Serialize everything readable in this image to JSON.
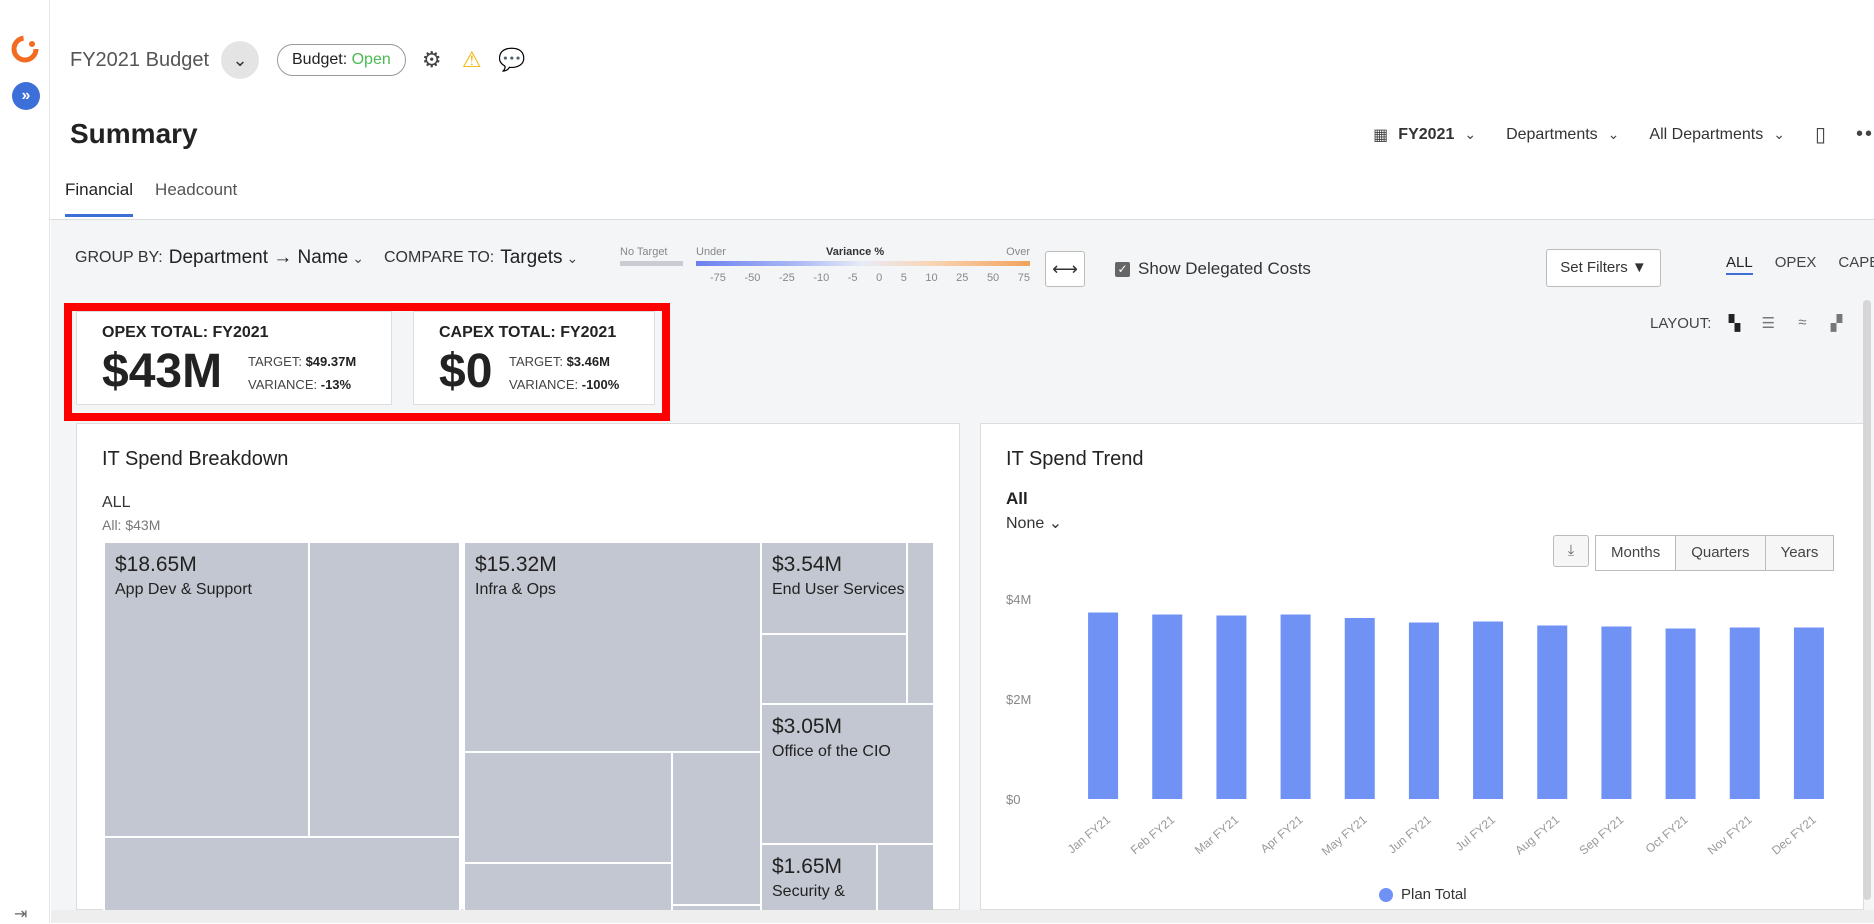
{
  "app": {
    "budget_title": "FY2021 Budget",
    "budget_status_label": "Budget:",
    "budget_status_value": "Open",
    "colors": {
      "accent": "#3d6fd8",
      "open": "#4cba53",
      "warn": "#f3b400",
      "bar": "#7092f5",
      "highlight": "#ff0000"
    }
  },
  "page": {
    "title": "Summary",
    "controls": {
      "period": "FY2021",
      "dimension": "Departments",
      "scope": "All Departments"
    },
    "tabs": [
      {
        "label": "Financial"
      },
      {
        "label": "Headcount"
      }
    ]
  },
  "toolbar": {
    "group_by_label": "GROUP BY:",
    "group_by_value": "Department → Name",
    "compare_to_label": "COMPARE TO:",
    "compare_to_value": "Targets",
    "legend": {
      "no_target": "No Target",
      "under": "Under",
      "variance": "Variance %",
      "over": "Over",
      "ticks": [
        "-75",
        "-50",
        "-25",
        "-10",
        "-5",
        "0",
        "5",
        "10",
        "25",
        "50",
        "75"
      ]
    },
    "show_delegated_costs": "Show Delegated Costs",
    "set_filters": "Set Filters",
    "type_tabs": [
      "ALL",
      "OPEX",
      "CAPEX"
    ],
    "layout_label": "LAYOUT:"
  },
  "kpis": [
    {
      "title": "OPEX TOTAL: FY2021",
      "value": "$43M",
      "target_label": "TARGET:",
      "target": "$49.37M",
      "variance_label": "VARIANCE:",
      "variance": "-13%"
    },
    {
      "title": "CAPEX TOTAL: FY2021",
      "value": "$0",
      "target_label": "TARGET:",
      "target": "$3.46M",
      "variance_label": "VARIANCE:",
      "variance": "-100%"
    }
  ],
  "breakdown": {
    "title": "IT Spend Breakdown",
    "level": "ALL",
    "total": "All: $43M",
    "cells": [
      {
        "value": "$18.65M",
        "name": "App Dev & Support"
      },
      {
        "value": "$15.32M",
        "name": "Infra & Ops"
      },
      {
        "value": "$3.54M",
        "name": "End User Services"
      },
      {
        "value": "$3.05M",
        "name": "Office of the CIO"
      },
      {
        "value": "$1.65M",
        "name": "Security &"
      }
    ]
  },
  "trend": {
    "title": "IT Spend Trend",
    "level": "All",
    "group": "None",
    "segments": [
      "Months",
      "Quarters",
      "Years"
    ],
    "selected_segment": "Months"
  },
  "chart_data": {
    "type": "bar",
    "categories": [
      "Jan FY21",
      "Feb FY21",
      "Mar FY21",
      "Apr FY21",
      "May FY21",
      "Jun FY21",
      "Jul FY21",
      "Aug FY21",
      "Sep FY21",
      "Oct FY21",
      "Nov FY21",
      "Dec FY21"
    ],
    "series": [
      {
        "name": "Plan Total",
        "values": [
          3.73,
          3.69,
          3.67,
          3.69,
          3.62,
          3.53,
          3.55,
          3.47,
          3.45,
          3.41,
          3.43,
          3.43
        ]
      }
    ],
    "y_ticks": [
      "$0",
      "$2M",
      "$4M"
    ],
    "ylim": [
      0,
      4
    ],
    "grid": false,
    "legend_position": "bottom-center"
  }
}
